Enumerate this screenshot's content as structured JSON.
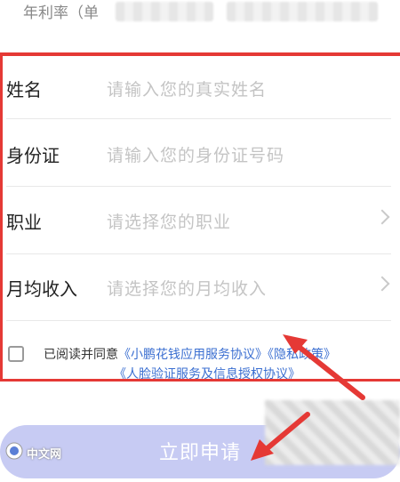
{
  "header": {
    "rate_label": "年利率（单"
  },
  "form": {
    "rows": [
      {
        "label": "姓名",
        "placeholder": "请输入您的真实姓名"
      },
      {
        "label": "身份证",
        "placeholder": "请输入您的身份证号码"
      },
      {
        "label": "职业",
        "placeholder": "请选择您的职业"
      },
      {
        "label": "月均收入",
        "placeholder": "请选择您的月均收入"
      }
    ]
  },
  "agreement": {
    "prefix": "已阅读并同意",
    "link1": "《小鹏花钱应用服务协议》",
    "link2": "《隐私政策》",
    "link3": "《人脸验证服务及信息授权协议》"
  },
  "submit": {
    "label": "立即申请"
  },
  "watermark": {
    "text": "中文网"
  },
  "colors": {
    "annotation_red": "#e53935",
    "button_disabled": "#c7cbf3",
    "link_blue": "#3b6fd1"
  }
}
